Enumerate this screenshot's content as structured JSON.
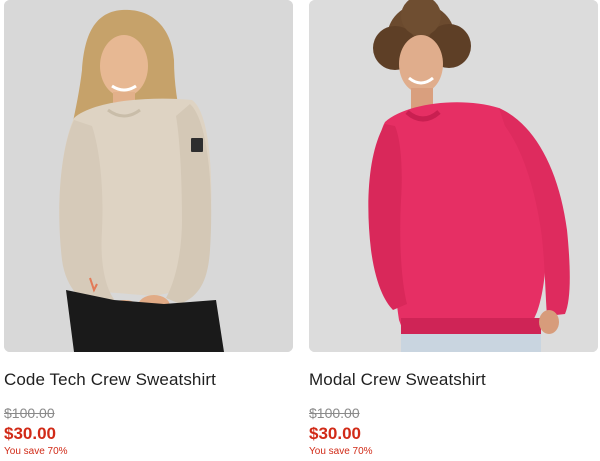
{
  "colors": {
    "sale_red": "#d12a17",
    "strike_gray": "#8a8a8a",
    "image_bg": "#d9d9d9"
  },
  "products": [
    {
      "name": "Code Tech Crew Sweatshirt",
      "was_price": "$100.00",
      "price": "$30.00",
      "savings": "You save 70%",
      "garment_color": "#ded3c3"
    },
    {
      "name": "Modal Crew Sweatshirt",
      "was_price": "$100.00",
      "price": "$30.00",
      "savings": "You save 70%",
      "garment_color": "#e62f64"
    }
  ]
}
